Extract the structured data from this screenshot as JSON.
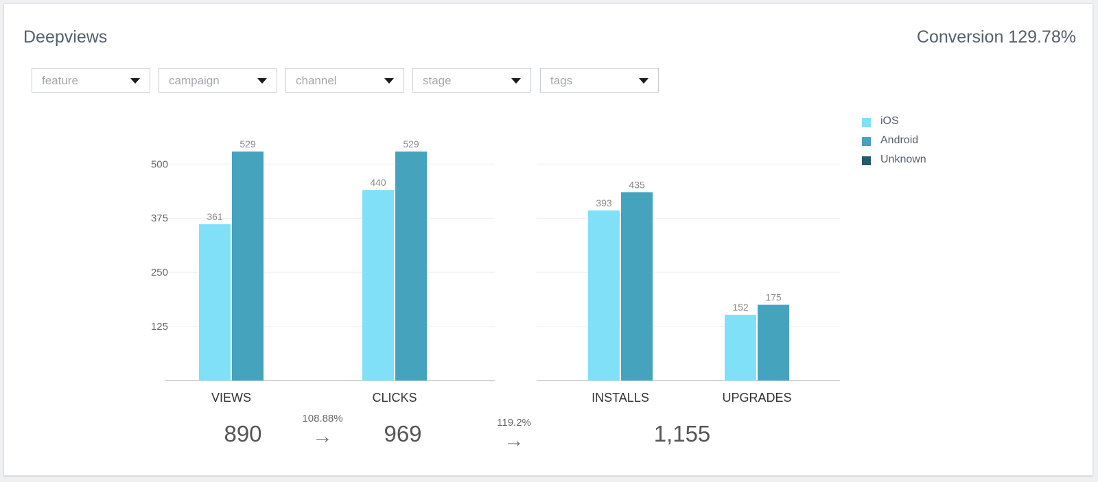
{
  "header": {
    "title": "Deepviews",
    "conversion": "Conversion 129.78%"
  },
  "filters": [
    {
      "label": "feature"
    },
    {
      "label": "campaign"
    },
    {
      "label": "channel"
    },
    {
      "label": "stage"
    },
    {
      "label": "tags"
    }
  ],
  "legend": [
    {
      "label": "iOS",
      "color": "#80e0f8"
    },
    {
      "label": "Android",
      "color": "#45a3be"
    },
    {
      "label": "Unknown",
      "color": "#225a6e"
    }
  ],
  "chart_data": {
    "type": "bar",
    "ylim": [
      0,
      529
    ],
    "yticks": [
      "125",
      "250",
      "375",
      "500"
    ],
    "grid": true,
    "legend_position": "top-right",
    "panels": [
      {
        "categories": [
          "VIEWS",
          "CLICKS"
        ],
        "series": [
          {
            "name": "iOS",
            "values": [
              361,
              440
            ],
            "labels": [
              "361",
              "440"
            ]
          },
          {
            "name": "Android",
            "values": [
              529,
              529
            ],
            "labels": [
              "529",
              "529"
            ]
          }
        ]
      },
      {
        "categories": [
          "INSTALLS",
          "UPGRADES"
        ],
        "series": [
          {
            "name": "iOS",
            "values": [
              393,
              152
            ],
            "labels": [
              "393",
              "152"
            ]
          },
          {
            "name": "Android",
            "values": [
              435,
              175
            ],
            "labels": [
              "435",
              "175"
            ]
          }
        ]
      }
    ]
  },
  "summary": {
    "views_total": "890",
    "clicks_total": "969",
    "installs_total": "1,155",
    "views_to_clicks": "108.88%",
    "clicks_to_installs": "119.2%",
    "arrow_icon": "→"
  }
}
